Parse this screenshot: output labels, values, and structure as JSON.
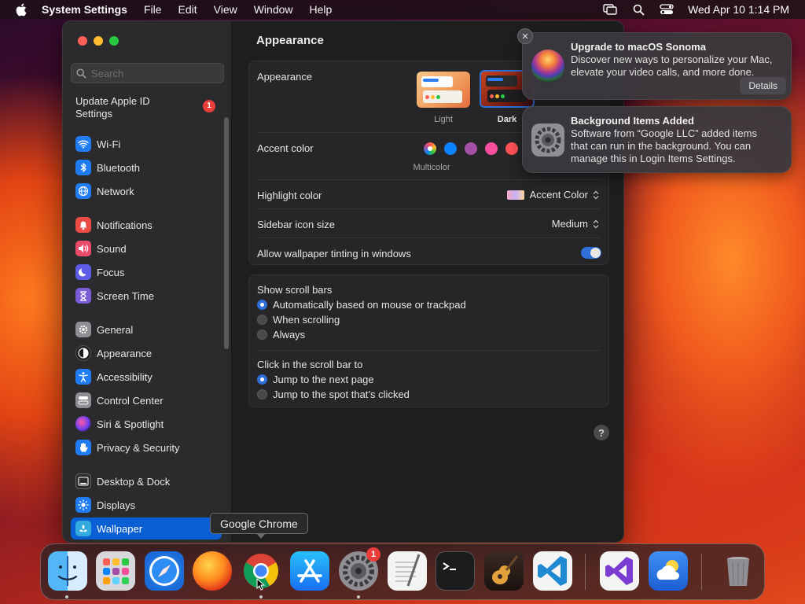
{
  "menubar": {
    "app_name": "System Settings",
    "items": [
      "File",
      "Edit",
      "View",
      "Window",
      "Help"
    ],
    "datetime": "Wed Apr 10  1:14 PM"
  },
  "sidebar": {
    "search_placeholder": "Search",
    "apple_id_label": "Update Apple ID Settings",
    "apple_id_badge": "1",
    "items": [
      {
        "label": "Wi-Fi",
        "icon": "wifi-icon",
        "color": "#1f7cf2"
      },
      {
        "label": "Bluetooth",
        "icon": "bluetooth-icon",
        "color": "#1f7cf2"
      },
      {
        "label": "Network",
        "icon": "globe-icon",
        "color": "#1f7cf2"
      },
      {
        "label": "Notifications",
        "icon": "bell-icon",
        "color": "#eb4b45"
      },
      {
        "label": "Sound",
        "icon": "speaker-icon",
        "color": "#eb4b6a"
      },
      {
        "label": "Focus",
        "icon": "moon-icon",
        "color": "#5e5ce6"
      },
      {
        "label": "Screen Time",
        "icon": "hourglass-icon",
        "color": "#7a5cd6"
      },
      {
        "label": "General",
        "icon": "gear-icon",
        "color": "#8e8e93"
      },
      {
        "label": "Appearance",
        "icon": "appearance-icon",
        "color": "#1c1c1e"
      },
      {
        "label": "Accessibility",
        "icon": "accessibility-icon",
        "color": "#1f7cf2"
      },
      {
        "label": "Control Center",
        "icon": "control-center-icon",
        "color": "#8e8e93"
      },
      {
        "label": "Siri & Spotlight",
        "icon": "siri-icon",
        "color": "#3a3a3c"
      },
      {
        "label": "Privacy & Security",
        "icon": "hand-icon",
        "color": "#1f7cf2"
      },
      {
        "label": "Desktop & Dock",
        "icon": "dock-icon",
        "color": "#3a3a3c"
      },
      {
        "label": "Displays",
        "icon": "sun-icon",
        "color": "#1f7cf2"
      },
      {
        "label": "Wallpaper",
        "icon": "wallpaper-icon",
        "color": "#33aadd"
      }
    ],
    "selected": "Wallpaper"
  },
  "content": {
    "title": "Appearance",
    "appearance_label": "Appearance",
    "appearance_options": [
      "Light",
      "Dark"
    ],
    "appearance_selected": "Dark",
    "accent_label": "Accent color",
    "accent_selected_name": "Multicolor",
    "accent_colors": [
      "#8e8e93",
      "#0a84ff",
      "#a550a7",
      "#f74f9e",
      "#ff5257"
    ],
    "highlight_label": "Highlight color",
    "highlight_value": "Accent Color",
    "sidebar_icon_label": "Sidebar icon size",
    "sidebar_icon_value": "Medium",
    "tinting_label": "Allow wallpaper tinting in windows",
    "tinting_on": true,
    "scroll_bars_label": "Show scroll bars",
    "scroll_bars_options": [
      "Automatically based on mouse or trackpad",
      "When scrolling",
      "Always"
    ],
    "scroll_bars_selected": 0,
    "click_label": "Click in the scroll bar to",
    "click_options": [
      "Jump to the next page",
      "Jump to the spot that’s clicked"
    ],
    "click_selected": 0,
    "help": "?"
  },
  "notifications": [
    {
      "title": "Upgrade to macOS Sonoma",
      "body": "Discover new ways to personalize your Mac, elevate your video calls, and more done.",
      "button": "Details"
    },
    {
      "title": "Background Items Added",
      "body": "Software from “Google LLC” added items that can run in the background. You can manage this in Login Items Settings."
    }
  ],
  "tooltip": "Google Chrome",
  "dock": {
    "apps": [
      "Finder",
      "Launchpad",
      "Safari",
      "Firefox",
      "Google Chrome",
      "App Store",
      "System Settings",
      "TextEdit",
      "Terminal",
      "GarageBand",
      "Visual Studio Code",
      "Visual Studio",
      "Weather",
      "Trash"
    ],
    "settings_badge": "1"
  }
}
